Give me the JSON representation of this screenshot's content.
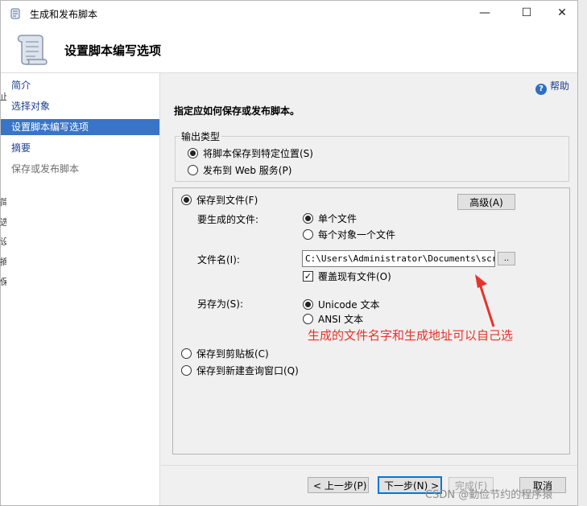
{
  "window": {
    "title": "生成和发布脚本",
    "minimize_glyph": "—",
    "maximize_glyph": "☐",
    "close_glyph": "✕"
  },
  "header": {
    "page_title": "设置脚本编写选项"
  },
  "background_strip": [
    "止",
    "简",
    "选",
    "设",
    "摘",
    "保"
  ],
  "nav": {
    "items": [
      {
        "label": "简介",
        "state": "link"
      },
      {
        "label": "选择对象",
        "state": "link"
      },
      {
        "label": "设置脚本编写选项",
        "state": "selected"
      },
      {
        "label": "摘要",
        "state": "link"
      },
      {
        "label": "保存或发布脚本",
        "state": "disabled"
      }
    ]
  },
  "help": {
    "label": "帮助",
    "icon": "question-icon",
    "glyph": "?"
  },
  "instruction": "指定应如何保存或发布脚本。",
  "output_type": {
    "group_label": "输出类型",
    "options": [
      {
        "label": "将脚本保存到特定位置(S)",
        "checked": true
      },
      {
        "label": "发布到 Web 服务(P)",
        "checked": false
      }
    ]
  },
  "save_options": {
    "save_to_file": {
      "label": "保存到文件(F)",
      "checked": true
    },
    "advanced_button": "高级(A)",
    "files_to_generate": {
      "label": "要生成的文件:",
      "options": [
        {
          "label": "单个文件",
          "checked": true
        },
        {
          "label": "每个对象一个文件",
          "checked": false
        }
      ]
    },
    "file_name": {
      "label": "文件名(I):",
      "value": "C:\\Users\\Administrator\\Documents\\script",
      "browse_label": ".."
    },
    "overwrite": {
      "label": "覆盖现有文件(O)",
      "checked": true,
      "check_glyph": "✓"
    },
    "save_as": {
      "label": "另存为(S):",
      "options": [
        {
          "label": "Unicode 文本",
          "checked": true
        },
        {
          "label": "ANSI 文本",
          "checked": false
        }
      ]
    },
    "save_to_clipboard": {
      "label": "保存到剪贴板(C)",
      "checked": false
    },
    "save_to_query_window": {
      "label": "保存到新建查询窗口(Q)",
      "checked": false
    }
  },
  "annotation": {
    "text": "生成的文件名字和生成地址可以自己选",
    "color": "#e8332a"
  },
  "footer": {
    "back": "< 上一步(P)",
    "next": "下一步(N) >",
    "finish": "完成(F)",
    "cancel": "取消"
  },
  "watermark": "CSDN @勤俭节约的程序猿"
}
